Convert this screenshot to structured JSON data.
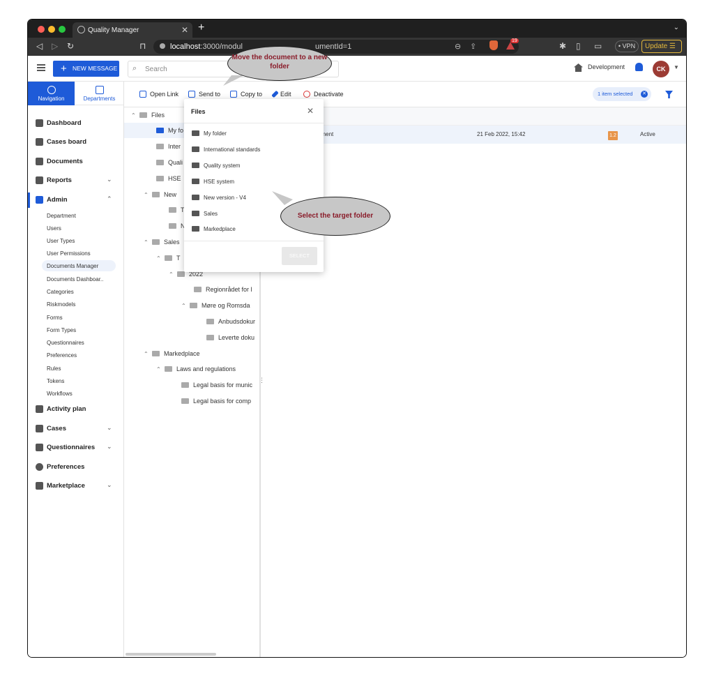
{
  "browser": {
    "tab_title": "Quality Manager",
    "url_host": "localhost",
    "url_rest": ":3000/modul",
    "url_tail": "umentId=1",
    "ext_badge": "19",
    "vpn": "• VPN",
    "update": "Update ☰"
  },
  "header": {
    "new_message": "NEW MESSAGE",
    "search_placeholder": "Search",
    "environment": "Development",
    "avatar": "CK"
  },
  "sidebar": {
    "tabs": [
      "Navigation",
      "Departments"
    ],
    "items": [
      {
        "label": "Dashboard",
        "icon": "dashboard-icon"
      },
      {
        "label": "Cases board",
        "icon": "board-icon"
      },
      {
        "label": "Documents",
        "icon": "folder-icon"
      },
      {
        "label": "Reports",
        "icon": "chart-icon",
        "expandable": true
      },
      {
        "label": "Admin",
        "icon": "gear-icon",
        "expandable": true,
        "expanded": true
      }
    ],
    "admin_children": [
      "Department",
      "Users",
      "User Types",
      "User Permissions",
      "Documents Manager",
      "Documents Dashboar..",
      "Categories",
      "Riskmodels",
      "Forms",
      "Form Types",
      "Questionnaires",
      "Preferences",
      "Rules",
      "Tokens",
      "Workflows"
    ],
    "admin_selected": "Documents Manager",
    "bottom_items": [
      {
        "label": "Activity plan",
        "icon": "calendar-icon"
      },
      {
        "label": "Cases",
        "icon": "cases-icon",
        "expandable": true
      },
      {
        "label": "Questionnaires",
        "icon": "clipboard-icon",
        "expandable": true
      },
      {
        "label": "Preferences",
        "icon": "gear-icon"
      },
      {
        "label": "Marketplace",
        "icon": "store-icon",
        "expandable": true
      }
    ]
  },
  "toolbar": {
    "open_link": "Open Link",
    "send_to": "Send to",
    "copy_to": "Copy to",
    "edit": "Edit",
    "deactivate": "Deactivate",
    "selected": "1 item selected"
  },
  "tree": {
    "root": "Files",
    "nodes": [
      "My fo",
      "Inter",
      "Quali",
      "HSE",
      "New",
      "T",
      "N",
      "Sales",
      "T",
      "2022",
      "Regionrådet for l",
      "Møre og Romsda",
      "Anbudsdokur",
      "Leverte doku",
      "Markedplace",
      "Laws and regulations",
      "Legal basis for munic",
      "Legal basis for comp"
    ]
  },
  "table": {
    "row": {
      "name": "cument",
      "date": "21 Feb 2022, 15:42",
      "version": "1.2",
      "status": "Active"
    }
  },
  "dialog": {
    "title": "Files",
    "folders": [
      "My folder",
      "International standards",
      "Quality system",
      "HSE system",
      "New version - V4",
      "Sales",
      "Markedplace"
    ],
    "select": "SELECT"
  },
  "callouts": {
    "move": "Move the document to a new folder",
    "select_target": "Select the target folder"
  },
  "colors": {
    "accent": "#1e5bd8",
    "callout_text": "#8a1c2a",
    "version_badge": "#e8954a"
  }
}
